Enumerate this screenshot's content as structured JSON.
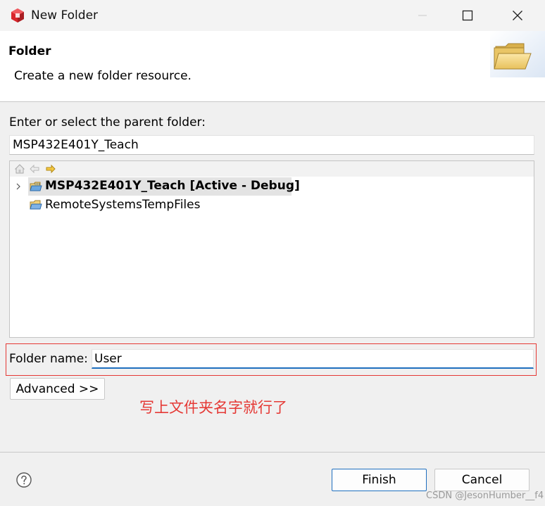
{
  "window": {
    "title": "New Folder",
    "icon": "ccs-cube-icon"
  },
  "header": {
    "title": "Folder",
    "description": "Create a new folder resource.",
    "image": "folder-icon"
  },
  "parent": {
    "label": "Enter or select the parent folder:",
    "value": "MSP432E401Y_Teach"
  },
  "tree": {
    "toolbar": [
      "home-icon",
      "back-icon",
      "forward-icon"
    ],
    "items": [
      {
        "label": "MSP432E401Y_Teach  [Active - Debug]",
        "selected": true,
        "expandable": true,
        "icon": "ccs-project-folder-icon"
      },
      {
        "label": "RemoteSystemsTempFiles",
        "selected": false,
        "expandable": false,
        "icon": "open-folder-icon"
      }
    ]
  },
  "folder_name": {
    "label": "Folder name:",
    "value": "User"
  },
  "advanced_label": "Advanced >>",
  "annotation": "写上文件夹名字就行了",
  "buttons": {
    "finish": "Finish",
    "cancel": "Cancel"
  },
  "watermark": "CSDN @JesonHumber__f4",
  "colors": {
    "accent": "#1f6fbf",
    "annotation": "#e53935",
    "selection": "#e3e3e3"
  }
}
